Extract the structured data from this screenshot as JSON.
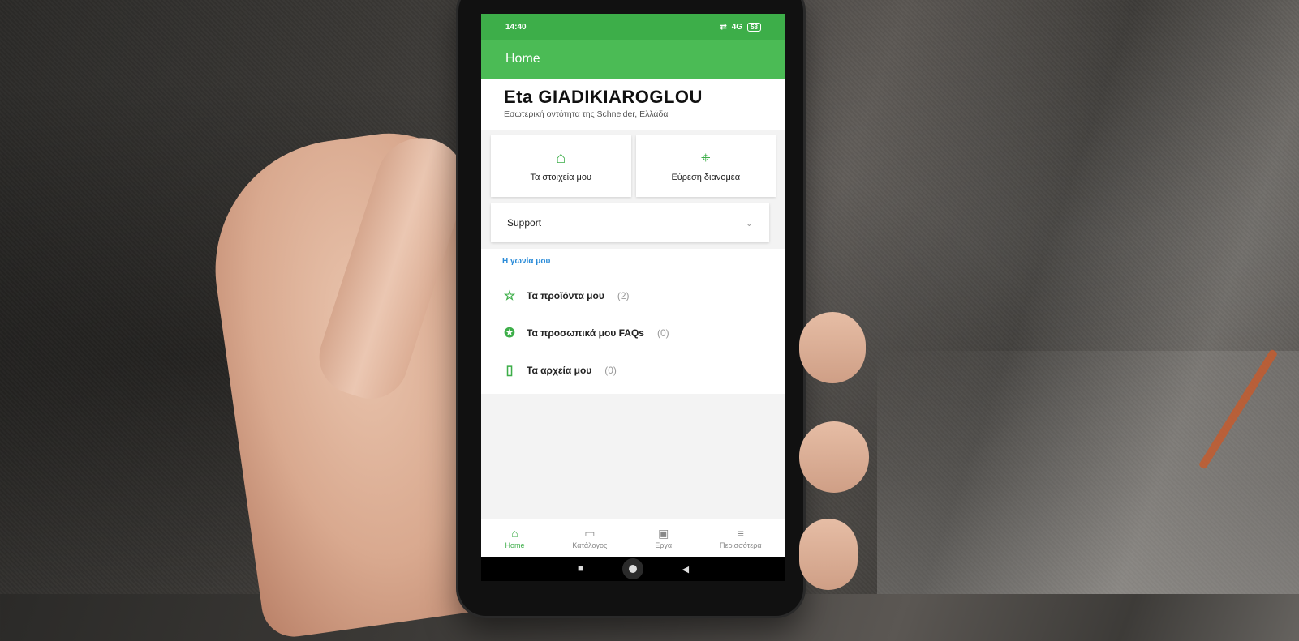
{
  "status": {
    "time": "14:40",
    "network": "4G",
    "battery": "58"
  },
  "appbar": {
    "title": "Home"
  },
  "profile": {
    "name": "Eta GIADIKIAROGLOU",
    "subtitle": "Εσωτερική οντότητα της Schneider, Ελλάδα"
  },
  "cards": [
    {
      "label": "Τα στοιχεία μου",
      "icon": "profile-house-icon"
    },
    {
      "label": "Εύρεση διανομέα",
      "icon": "location-pin-icon"
    }
  ],
  "support": {
    "label": "Support",
    "icon": "chevron-down-icon"
  },
  "corner": {
    "title": "Η γωνία μου",
    "items": [
      {
        "label": "Τα προϊόντα μου",
        "count": "(2)",
        "icon": "product-star-icon"
      },
      {
        "label": "Τα προσωπικά μου FAQs",
        "count": "(0)",
        "icon": "faq-star-icon"
      },
      {
        "label": "Τα αρχεία μου",
        "count": "(0)",
        "icon": "file-star-icon"
      }
    ]
  },
  "bottom_nav": [
    {
      "label": "Home",
      "icon": "home-icon",
      "active": true
    },
    {
      "label": "Κατάλογος",
      "icon": "book-icon",
      "active": false
    },
    {
      "label": "Εργα",
      "icon": "briefcase-icon",
      "active": false
    },
    {
      "label": "Περισσότερα",
      "icon": "menu-icon",
      "active": false
    }
  ],
  "colors": {
    "brand_green": "#3dae49",
    "link_blue": "#2a8bd8"
  }
}
